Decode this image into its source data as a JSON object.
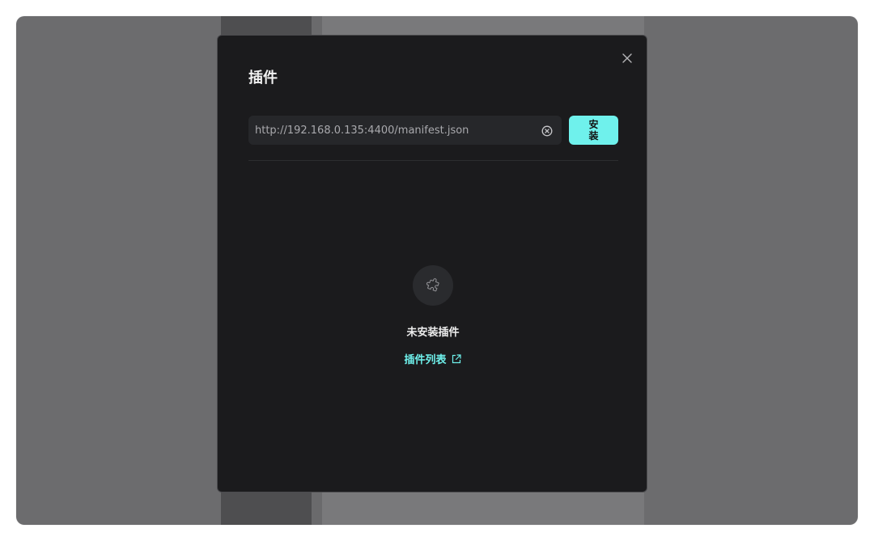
{
  "modal": {
    "title": "插件",
    "url_input": {
      "value": "http://192.168.0.135:4400/manifest.json",
      "placeholder": ""
    },
    "install_label": "安装",
    "empty_text": "未安装插件",
    "plugin_list_link": "插件列表"
  },
  "icons": {
    "close": "close-icon",
    "clear": "clear-circle-icon",
    "empty": "puzzle-icon",
    "external": "external-link-icon"
  },
  "colors": {
    "accent": "#6ff1ec",
    "modal_bg": "#1b1b1d",
    "input_bg": "#26272a"
  }
}
